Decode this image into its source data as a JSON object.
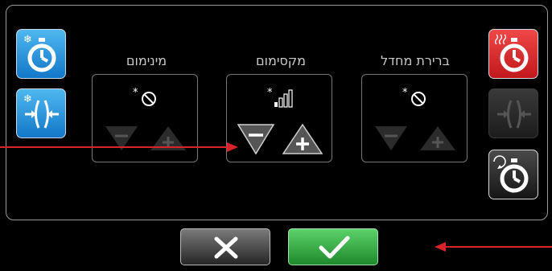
{
  "columns": [
    {
      "label": "מינימום",
      "mode_icon": "snowflake-off-icon",
      "enabled": false
    },
    {
      "label": "מקסימום",
      "mode_icon": "snowflake-signal-bars-icon",
      "enabled": true
    },
    {
      "label": "ברירת מחדל",
      "mode_icon": "snowflake-off-icon",
      "enabled": false
    }
  ],
  "left_buttons": [
    {
      "icon": "freeze-timer-icon",
      "color": "#1a86d6"
    },
    {
      "icon": "freeze-compress-icon",
      "color": "#1a86d6"
    }
  ],
  "right_buttons": [
    {
      "icon": "heat-timer-icon",
      "color": "#d92226"
    },
    {
      "icon": "compress-icon-disabled",
      "color": "#2a2a2a"
    },
    {
      "icon": "cycle-timer-icon",
      "color": "#2a2a2a"
    }
  ],
  "footer": {
    "cancel_icon": "x-icon",
    "confirm_icon": "check-icon"
  },
  "colors": {
    "accent_blue": "#1a86d6",
    "accent_red": "#d92226",
    "confirm_green": "#2fae3f",
    "annotation_arrow": "#d8232a"
  }
}
